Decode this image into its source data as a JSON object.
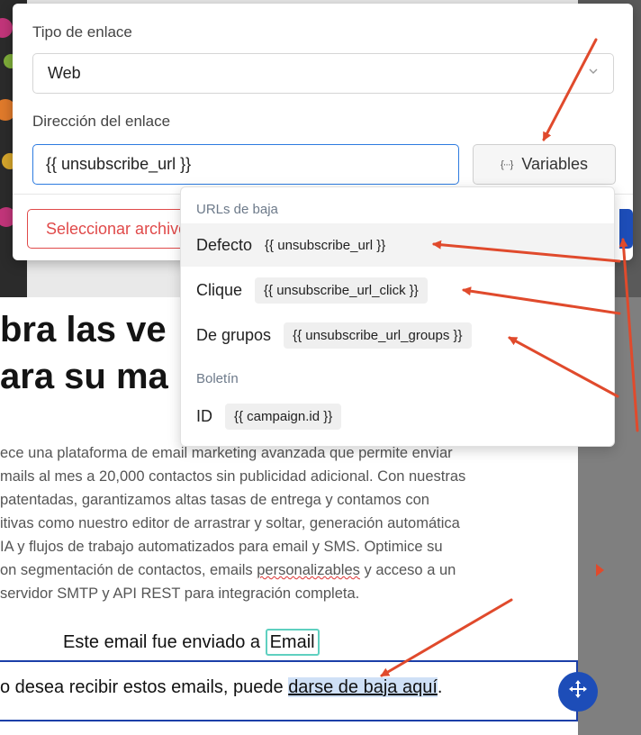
{
  "link_modal": {
    "link_type_label": "Tipo de enlace",
    "link_type_value": "Web",
    "link_address_label": "Dirección del enlace",
    "link_address_value": "{{ unsubscribe_url }}",
    "variables_button_label": "Variables",
    "variables_icon_glyph": "{···}",
    "select_file_label": "Seleccionar archivo"
  },
  "variables_dropdown": {
    "groups": [
      {
        "label": "URLs de baja",
        "items": [
          {
            "name": "Defecto",
            "value": "{{ unsubscribe_url }}"
          },
          {
            "name": "Clique",
            "value": "{{ unsubscribe_url_click }}"
          },
          {
            "name": "De grupos",
            "value": "{{ unsubscribe_url_groups }}"
          }
        ]
      },
      {
        "label": "Boletín",
        "items": [
          {
            "name": "ID",
            "value": "{{ campaign.id }}"
          }
        ]
      }
    ]
  },
  "email_content": {
    "headline_lines": [
      "bra las ve",
      "ara su ma"
    ],
    "body_lines": [
      "ece una plataforma de email marketing avanzada que permite enviar",
      "mails al mes a 20,000 contactos sin publicidad adicional. Con nuestras",
      "patentadas, garantizamos altas tasas de entrega y contamos con",
      "itivas como nuestro editor de arrastrar y soltar, generación automática",
      "IA y flujos de trabajo automatizados para email y SMS. Optimice su",
      "on segmentación de contactos, emails ",
      "personalizables",
      " y acceso a un",
      "servidor SMTP y API REST para integración completa."
    ],
    "footer_sent_prefix": "Este email fue enviado a ",
    "footer_email_chip": "Email",
    "footer_unsub_prefix": "o desea recibir estos emails, puede ",
    "footer_unsub_link": "darse de baja aquí",
    "footer_unsub_suffix": "."
  },
  "colors": {
    "accent_blue": "#1d4db8",
    "input_focus": "#2d7be0",
    "danger": "#e04a4a",
    "annotation": "#e04a2c"
  }
}
